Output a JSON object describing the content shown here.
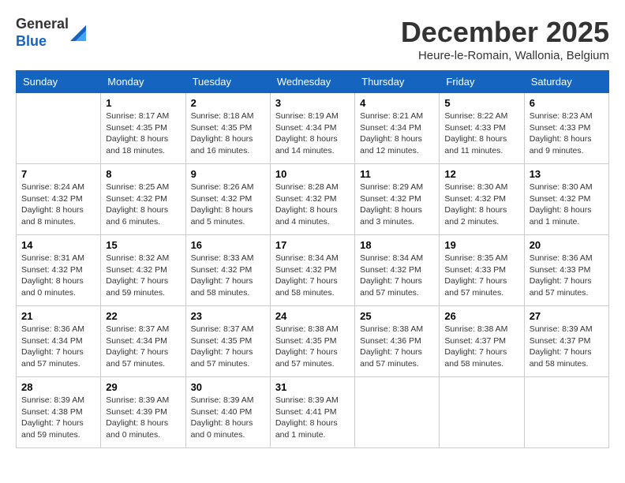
{
  "header": {
    "logo_general": "General",
    "logo_blue": "Blue",
    "month": "December 2025",
    "location": "Heure-le-Romain, Wallonia, Belgium"
  },
  "days_of_week": [
    "Sunday",
    "Monday",
    "Tuesday",
    "Wednesday",
    "Thursday",
    "Friday",
    "Saturday"
  ],
  "weeks": [
    [
      {
        "day": "",
        "info": ""
      },
      {
        "day": "1",
        "info": "Sunrise: 8:17 AM\nSunset: 4:35 PM\nDaylight: 8 hours\nand 18 minutes."
      },
      {
        "day": "2",
        "info": "Sunrise: 8:18 AM\nSunset: 4:35 PM\nDaylight: 8 hours\nand 16 minutes."
      },
      {
        "day": "3",
        "info": "Sunrise: 8:19 AM\nSunset: 4:34 PM\nDaylight: 8 hours\nand 14 minutes."
      },
      {
        "day": "4",
        "info": "Sunrise: 8:21 AM\nSunset: 4:34 PM\nDaylight: 8 hours\nand 12 minutes."
      },
      {
        "day": "5",
        "info": "Sunrise: 8:22 AM\nSunset: 4:33 PM\nDaylight: 8 hours\nand 11 minutes."
      },
      {
        "day": "6",
        "info": "Sunrise: 8:23 AM\nSunset: 4:33 PM\nDaylight: 8 hours\nand 9 minutes."
      }
    ],
    [
      {
        "day": "7",
        "info": "Sunrise: 8:24 AM\nSunset: 4:32 PM\nDaylight: 8 hours\nand 8 minutes."
      },
      {
        "day": "8",
        "info": "Sunrise: 8:25 AM\nSunset: 4:32 PM\nDaylight: 8 hours\nand 6 minutes."
      },
      {
        "day": "9",
        "info": "Sunrise: 8:26 AM\nSunset: 4:32 PM\nDaylight: 8 hours\nand 5 minutes."
      },
      {
        "day": "10",
        "info": "Sunrise: 8:28 AM\nSunset: 4:32 PM\nDaylight: 8 hours\nand 4 minutes."
      },
      {
        "day": "11",
        "info": "Sunrise: 8:29 AM\nSunset: 4:32 PM\nDaylight: 8 hours\nand 3 minutes."
      },
      {
        "day": "12",
        "info": "Sunrise: 8:30 AM\nSunset: 4:32 PM\nDaylight: 8 hours\nand 2 minutes."
      },
      {
        "day": "13",
        "info": "Sunrise: 8:30 AM\nSunset: 4:32 PM\nDaylight: 8 hours\nand 1 minute."
      }
    ],
    [
      {
        "day": "14",
        "info": "Sunrise: 8:31 AM\nSunset: 4:32 PM\nDaylight: 8 hours\nand 0 minutes."
      },
      {
        "day": "15",
        "info": "Sunrise: 8:32 AM\nSunset: 4:32 PM\nDaylight: 7 hours\nand 59 minutes."
      },
      {
        "day": "16",
        "info": "Sunrise: 8:33 AM\nSunset: 4:32 PM\nDaylight: 7 hours\nand 58 minutes."
      },
      {
        "day": "17",
        "info": "Sunrise: 8:34 AM\nSunset: 4:32 PM\nDaylight: 7 hours\nand 58 minutes."
      },
      {
        "day": "18",
        "info": "Sunrise: 8:34 AM\nSunset: 4:32 PM\nDaylight: 7 hours\nand 57 minutes."
      },
      {
        "day": "19",
        "info": "Sunrise: 8:35 AM\nSunset: 4:33 PM\nDaylight: 7 hours\nand 57 minutes."
      },
      {
        "day": "20",
        "info": "Sunrise: 8:36 AM\nSunset: 4:33 PM\nDaylight: 7 hours\nand 57 minutes."
      }
    ],
    [
      {
        "day": "21",
        "info": "Sunrise: 8:36 AM\nSunset: 4:34 PM\nDaylight: 7 hours\nand 57 minutes."
      },
      {
        "day": "22",
        "info": "Sunrise: 8:37 AM\nSunset: 4:34 PM\nDaylight: 7 hours\nand 57 minutes."
      },
      {
        "day": "23",
        "info": "Sunrise: 8:37 AM\nSunset: 4:35 PM\nDaylight: 7 hours\nand 57 minutes."
      },
      {
        "day": "24",
        "info": "Sunrise: 8:38 AM\nSunset: 4:35 PM\nDaylight: 7 hours\nand 57 minutes."
      },
      {
        "day": "25",
        "info": "Sunrise: 8:38 AM\nSunset: 4:36 PM\nDaylight: 7 hours\nand 57 minutes."
      },
      {
        "day": "26",
        "info": "Sunrise: 8:38 AM\nSunset: 4:37 PM\nDaylight: 7 hours\nand 58 minutes."
      },
      {
        "day": "27",
        "info": "Sunrise: 8:39 AM\nSunset: 4:37 PM\nDaylight: 7 hours\nand 58 minutes."
      }
    ],
    [
      {
        "day": "28",
        "info": "Sunrise: 8:39 AM\nSunset: 4:38 PM\nDaylight: 7 hours\nand 59 minutes."
      },
      {
        "day": "29",
        "info": "Sunrise: 8:39 AM\nSunset: 4:39 PM\nDaylight: 8 hours\nand 0 minutes."
      },
      {
        "day": "30",
        "info": "Sunrise: 8:39 AM\nSunset: 4:40 PM\nDaylight: 8 hours\nand 0 minutes."
      },
      {
        "day": "31",
        "info": "Sunrise: 8:39 AM\nSunset: 4:41 PM\nDaylight: 8 hours\nand 1 minute."
      },
      {
        "day": "",
        "info": ""
      },
      {
        "day": "",
        "info": ""
      },
      {
        "day": "",
        "info": ""
      }
    ]
  ]
}
